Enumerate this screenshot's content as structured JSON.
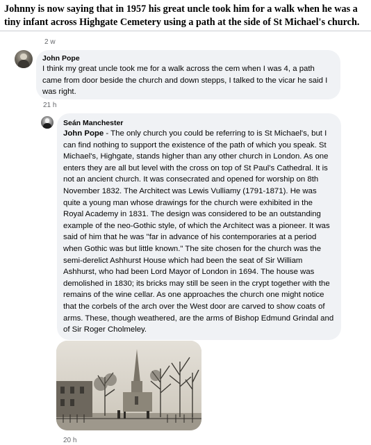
{
  "headline": "Johnny is now saying that in 1957 his great uncle took him for a walk when he was a tiny infant across Highgate Cemetery using a path at the side of St Michael's  church.",
  "thread": {
    "top_timestamp": "2 w",
    "comments": [
      {
        "author": "John Pope",
        "text": "I think my great uncle took me for a walk across the cem when I was 4, a path came from door beside the church and down stepps, I talked to the vicar he said I was right.",
        "timestamp": "21 h"
      },
      {
        "author": "Seán Manchester",
        "mention": "John Pope",
        "text": " - The only church you could be referring to is St Michael's, but I can find nothing to support the existence of the path of which you speak. St Michael's, Highgate, stands higher than any other church in London. As one enters they are all but level with the cross on top of St Paul's Cathedral. It is not an ancient church. It was consecrated and opened for worship on 8th November 1832. The Architect was Lewis Vulliamy (1791-1871). He was quite a young man whose drawings for the church were exhibited in the Royal Academy in 1831. The design was considered to be an outstanding example of the neo-Gothic style, of which the Architect was a pioneer. It was said of him that he was \"far in advance of his contemporaries at a period when Gothic was but little known.\" The site chosen for the church was the semi-derelict Ashhurst House which had been the seat of Sir William Ashhurst, who had been Lord Mayor of London in 1694. The house was demolished in 1830; its bricks may still be seen in the crypt together with the remains of the wine cellar. As one approaches the church one might notice that the corbels of the arch over the West door are carved to show coats of arms. These, though weathered, are the arms of Bishop Edmund Grindal and of Sir Roger Cholmeley.",
        "timestamp": "20 h"
      }
    ]
  },
  "colors": {
    "bubble": "#f0f2f5",
    "timestamp": "#65676b",
    "text": "#050505"
  }
}
